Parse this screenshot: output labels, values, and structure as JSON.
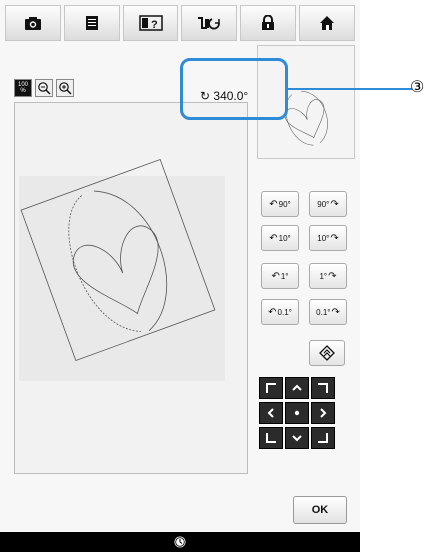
{
  "toolbar": {
    "items": [
      {
        "icon": "camera-icon"
      },
      {
        "icon": "document-icon"
      },
      {
        "icon": "help-icon"
      },
      {
        "icon": "settings-icon"
      },
      {
        "icon": "lock-icon"
      },
      {
        "icon": "home-icon"
      }
    ]
  },
  "zoom": {
    "percent_top": "100",
    "percent_bottom": "%",
    "zoom_out": "−",
    "zoom_in": "+"
  },
  "angle": {
    "symbol": "↻",
    "value": "340.0°"
  },
  "callout": {
    "number": "③"
  },
  "rotate": {
    "left_90": "90°",
    "right_90": "90°",
    "left_10": "10°",
    "right_10": "10°",
    "left_1": "1°",
    "right_1": "1°",
    "left_0_1": "0.1°",
    "right_0_1": "0.1°"
  },
  "ok_label": "OK",
  "colors": {
    "accent": "#2e8bd8",
    "nav_button": "#2b2b2b"
  }
}
